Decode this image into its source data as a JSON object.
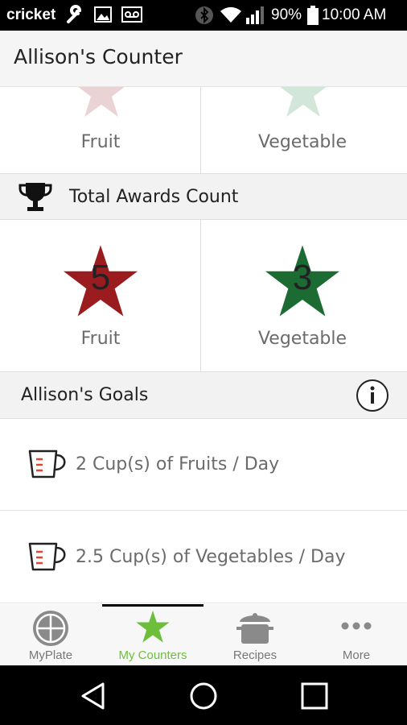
{
  "status_bar": {
    "carrier": "cricket",
    "battery": "90%",
    "time": "10:00 AM",
    "icons": [
      "wrench-icon",
      "image-icon",
      "voicemail-icon",
      "bluetooth-icon",
      "wifi-icon",
      "signal-icon",
      "battery-icon"
    ]
  },
  "app_bar": {
    "title": "Allison's Counter"
  },
  "previous_awards": {
    "fruit_label": "Fruit",
    "vegetable_label": "Vegetable"
  },
  "total_awards": {
    "header": "Total Awards Count",
    "fruit": {
      "count": "5",
      "label": "Fruit",
      "color": "#9b1c1f"
    },
    "vegetable": {
      "count": "3",
      "label": "Vegetable",
      "color": "#1b6b33"
    }
  },
  "goals": {
    "header": "Allison's Goals",
    "items": [
      {
        "text": "2 Cup(s) of Fruits / Day"
      },
      {
        "text": "2.5 Cup(s) of Vegetables / Day"
      }
    ]
  },
  "tabs": [
    {
      "label": "MyPlate",
      "icon": "myplate-icon",
      "active": false
    },
    {
      "label": "My Counters",
      "icon": "star-icon",
      "active": true
    },
    {
      "label": "Recipes",
      "icon": "pot-icon",
      "active": false
    },
    {
      "label": "More",
      "icon": "more-dots-icon",
      "active": false
    }
  ],
  "colors": {
    "accent_green": "#6dbf3b",
    "fruit_faded": "#ead3d5",
    "vegetable_faded": "#d3e6da"
  }
}
